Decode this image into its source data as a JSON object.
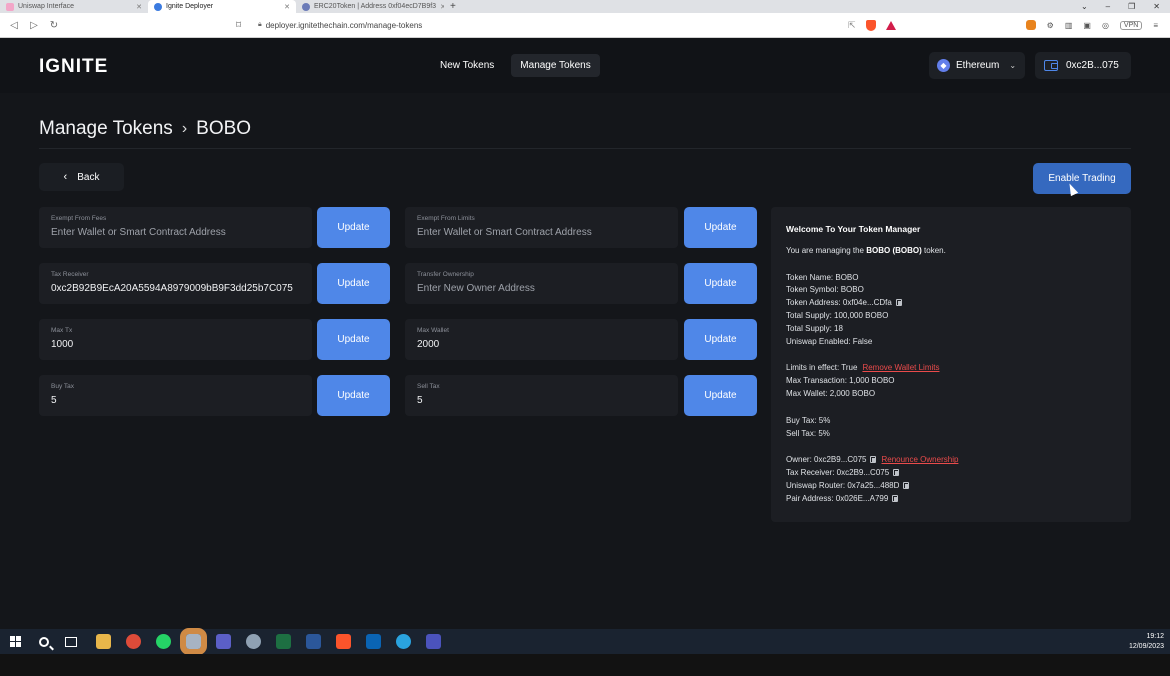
{
  "browser": {
    "tabs": [
      {
        "label": "Uniswap Interface",
        "active": false
      },
      {
        "label": "Ignite Deployer",
        "active": true
      },
      {
        "label": "ERC20Token | Address 0xf04ecD7B9f3",
        "active": false
      }
    ],
    "new_tab": "+",
    "url": "deployer.ignitethechain.com/manage-tokens",
    "vpn": "VPN"
  },
  "header": {
    "logo": "IGNITE",
    "nav": [
      {
        "label": "New Tokens",
        "active": false
      },
      {
        "label": "Manage Tokens",
        "active": true
      }
    ],
    "network": "Ethereum",
    "wallet": "0xc2B...075"
  },
  "page": {
    "title": "Manage Tokens",
    "separator": "›",
    "token": "BOBO",
    "back_label": "Back",
    "enable_trading_label": "Enable Trading"
  },
  "fields": [
    {
      "label": "Exempt From Fees",
      "value": "",
      "placeholder": "Enter Wallet or Smart Contract Address",
      "button": "Update"
    },
    {
      "label": "Exempt From Limits",
      "value": "",
      "placeholder": "Enter Wallet or Smart Contract Address",
      "button": "Update"
    },
    {
      "label": "Tax Receiver",
      "value": "0xc2B92B9EcA20A5594A8979009bB9F3dd25b7C075",
      "placeholder": "",
      "button": "Update"
    },
    {
      "label": "Transfer Ownership",
      "value": "",
      "placeholder": "Enter New Owner Address",
      "button": "Update"
    },
    {
      "label": "Max Tx",
      "value": "1000",
      "placeholder": "",
      "button": "Update"
    },
    {
      "label": "Max Wallet",
      "value": "2000",
      "placeholder": "",
      "button": "Update"
    },
    {
      "label": "Buy Tax",
      "value": "5",
      "placeholder": "",
      "button": "Update"
    },
    {
      "label": "Sell Tax",
      "value": "5",
      "placeholder": "",
      "button": "Update"
    }
  ],
  "info": {
    "welcome": "Welcome To Your Token Manager",
    "managing_prefix": "You are managing the",
    "managing_token": "BOBO (BOBO)",
    "managing_suffix": "token.",
    "token_name": "Token Name: BOBO",
    "token_symbol": "Token Symbol: BOBO",
    "token_address": "Token Address: 0xf04e...CDfa",
    "total_supply": "Total Supply: 100,000 BOBO",
    "total_supply_2": "Total Supply: 18",
    "uniswap_enabled": "Uniswap Enabled: False",
    "limits": "Limits in effect: True",
    "remove_limits": "Remove Wallet Limits",
    "max_tx": "Max Transaction: 1,000 BOBO",
    "max_wallet": "Max Wallet: 2,000 BOBO",
    "buy_tax": "Buy Tax: 5%",
    "sell_tax": "Sell Tax: 5%",
    "owner": "Owner: 0xc2B9...C075",
    "renounce": "Renounce Ownership",
    "tax_receiver": "Tax Receiver: 0xc2B9...C075",
    "router": "Uniswap Router: 0x7a25...488D",
    "pair": "Pair Address: 0x026E...A799"
  },
  "taskbar": {
    "time": "19:12",
    "date": "12/09/2023"
  },
  "colors": {
    "accent": "#4f87e8",
    "enable": "#3569bf",
    "danger": "#ea4b4b",
    "panel": "#1c1e23",
    "background": "#14161a"
  }
}
